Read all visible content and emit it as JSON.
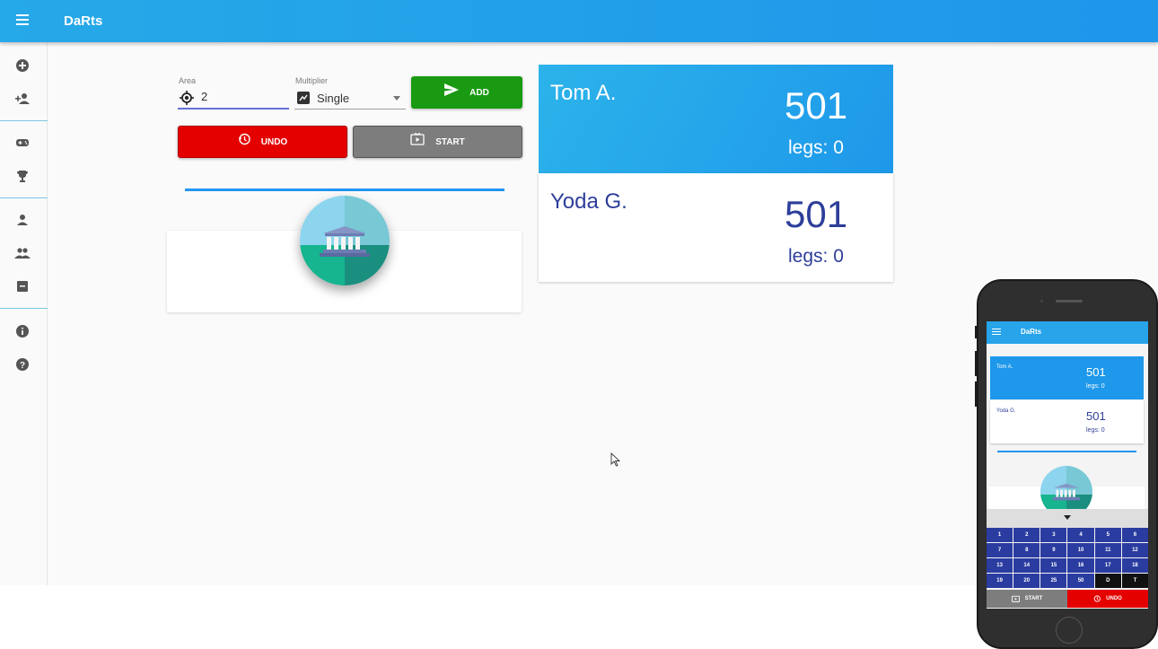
{
  "app": {
    "title": "DaRts"
  },
  "colors": {
    "primary": "#26a9e8",
    "add": "#199a12",
    "undo": "#e50000",
    "start": "#7d7d7d",
    "player_text": "#2d3e9a"
  },
  "sidebar": {
    "items": [
      {
        "icon": "add-circle-icon"
      },
      {
        "icon": "person-add-icon"
      },
      {
        "icon": "gamepad-icon"
      },
      {
        "icon": "trophy-icon"
      },
      {
        "icon": "person-icon"
      },
      {
        "icon": "group-icon"
      },
      {
        "icon": "archive-icon"
      },
      {
        "icon": "info-icon"
      },
      {
        "icon": "help-icon"
      }
    ]
  },
  "form": {
    "area_label": "Area",
    "area_value": "2",
    "multiplier_label": "Multiplier",
    "multiplier_value": "Single",
    "add_label": "ADD",
    "undo_label": "UNDO",
    "start_label": "START"
  },
  "players": [
    {
      "name": "Tom A.",
      "score": "501",
      "legs": "legs: 0",
      "active": true
    },
    {
      "name": "Yoda G.",
      "score": "501",
      "legs": "legs: 0",
      "active": false
    }
  ],
  "mobile": {
    "title": "DaRts",
    "players": [
      {
        "name": "Tom A.",
        "score": "501",
        "legs": "legs: 0"
      },
      {
        "name": "Yoda G.",
        "score": "501",
        "legs": "legs: 0"
      }
    ],
    "keys": [
      "1",
      "2",
      "3",
      "4",
      "5",
      "6",
      "7",
      "8",
      "9",
      "10",
      "11",
      "12",
      "13",
      "14",
      "15",
      "16",
      "17",
      "18",
      "19",
      "20",
      "25",
      "50",
      "D",
      "T"
    ],
    "start_label": "START",
    "undo_label": "UNDO"
  }
}
